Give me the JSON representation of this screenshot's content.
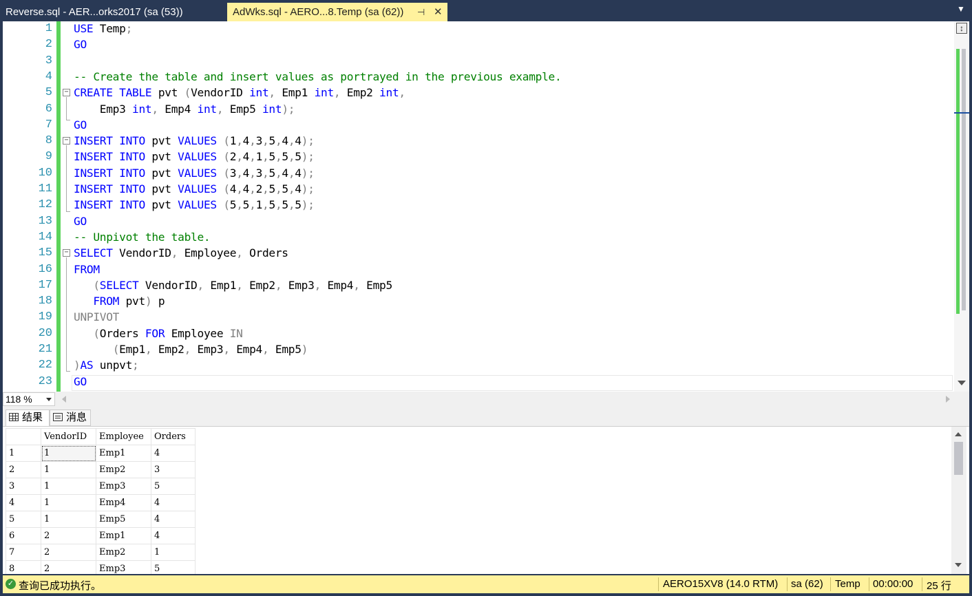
{
  "tabs": [
    {
      "label": "Reverse.sql - AER...orks2017 (sa (53))",
      "active": false
    },
    {
      "label": "AdWks.sql - AERO...8.Temp (sa (62))",
      "active": true
    }
  ],
  "tab_icons": {
    "pin": "pin-icon",
    "close": "close-icon",
    "overflow": "chevron-down-icon"
  },
  "editor": {
    "line_numbers": [
      "1",
      "2",
      "3",
      "4",
      "5",
      "6",
      "7",
      "8",
      "9",
      "10",
      "11",
      "12",
      "13",
      "14",
      "15",
      "16",
      "17",
      "18",
      "19",
      "20",
      "21",
      "22",
      "23"
    ],
    "lines": [
      [
        {
          "t": "USE",
          "c": "kw"
        },
        {
          "t": " Temp"
        },
        {
          "t": ";",
          "c": "gr"
        }
      ],
      [
        {
          "t": "GO",
          "c": "kw"
        }
      ],
      [],
      [
        {
          "t": "-- Create the table and insert values as portrayed in the previous example.",
          "c": "cm"
        }
      ],
      [
        {
          "t": "CREATE",
          "c": "kw"
        },
        {
          "t": " "
        },
        {
          "t": "TABLE",
          "c": "kw"
        },
        {
          "t": " pvt "
        },
        {
          "t": "(",
          "c": "gr"
        },
        {
          "t": "VendorID "
        },
        {
          "t": "int",
          "c": "kw"
        },
        {
          "t": ",",
          "c": "gr"
        },
        {
          "t": " Emp1 "
        },
        {
          "t": "int",
          "c": "kw"
        },
        {
          "t": ",",
          "c": "gr"
        },
        {
          "t": " Emp2 "
        },
        {
          "t": "int",
          "c": "kw"
        },
        {
          "t": ",",
          "c": "gr"
        }
      ],
      [
        {
          "t": "    Emp3 "
        },
        {
          "t": "int",
          "c": "kw"
        },
        {
          "t": ",",
          "c": "gr"
        },
        {
          "t": " Emp4 "
        },
        {
          "t": "int",
          "c": "kw"
        },
        {
          "t": ",",
          "c": "gr"
        },
        {
          "t": " Emp5 "
        },
        {
          "t": "int",
          "c": "kw"
        },
        {
          "t": ");",
          "c": "gr"
        }
      ],
      [
        {
          "t": "GO",
          "c": "kw"
        }
      ],
      [
        {
          "t": "INSERT",
          "c": "kw"
        },
        {
          "t": " "
        },
        {
          "t": "INTO",
          "c": "kw"
        },
        {
          "t": " pvt "
        },
        {
          "t": "VALUES",
          "c": "kw"
        },
        {
          "t": " "
        },
        {
          "t": "(",
          "c": "gr"
        },
        {
          "t": "1"
        },
        {
          "t": ",",
          "c": "gr"
        },
        {
          "t": "4"
        },
        {
          "t": ",",
          "c": "gr"
        },
        {
          "t": "3"
        },
        {
          "t": ",",
          "c": "gr"
        },
        {
          "t": "5"
        },
        {
          "t": ",",
          "c": "gr"
        },
        {
          "t": "4"
        },
        {
          "t": ",",
          "c": "gr"
        },
        {
          "t": "4"
        },
        {
          "t": ");",
          "c": "gr"
        }
      ],
      [
        {
          "t": "INSERT",
          "c": "kw"
        },
        {
          "t": " "
        },
        {
          "t": "INTO",
          "c": "kw"
        },
        {
          "t": " pvt "
        },
        {
          "t": "VALUES",
          "c": "kw"
        },
        {
          "t": " "
        },
        {
          "t": "(",
          "c": "gr"
        },
        {
          "t": "2"
        },
        {
          "t": ",",
          "c": "gr"
        },
        {
          "t": "4"
        },
        {
          "t": ",",
          "c": "gr"
        },
        {
          "t": "1"
        },
        {
          "t": ",",
          "c": "gr"
        },
        {
          "t": "5"
        },
        {
          "t": ",",
          "c": "gr"
        },
        {
          "t": "5"
        },
        {
          "t": ",",
          "c": "gr"
        },
        {
          "t": "5"
        },
        {
          "t": ");",
          "c": "gr"
        }
      ],
      [
        {
          "t": "INSERT",
          "c": "kw"
        },
        {
          "t": " "
        },
        {
          "t": "INTO",
          "c": "kw"
        },
        {
          "t": " pvt "
        },
        {
          "t": "VALUES",
          "c": "kw"
        },
        {
          "t": " "
        },
        {
          "t": "(",
          "c": "gr"
        },
        {
          "t": "3"
        },
        {
          "t": ",",
          "c": "gr"
        },
        {
          "t": "4"
        },
        {
          "t": ",",
          "c": "gr"
        },
        {
          "t": "3"
        },
        {
          "t": ",",
          "c": "gr"
        },
        {
          "t": "5"
        },
        {
          "t": ",",
          "c": "gr"
        },
        {
          "t": "4"
        },
        {
          "t": ",",
          "c": "gr"
        },
        {
          "t": "4"
        },
        {
          "t": ");",
          "c": "gr"
        }
      ],
      [
        {
          "t": "INSERT",
          "c": "kw"
        },
        {
          "t": " "
        },
        {
          "t": "INTO",
          "c": "kw"
        },
        {
          "t": " pvt "
        },
        {
          "t": "VALUES",
          "c": "kw"
        },
        {
          "t": " "
        },
        {
          "t": "(",
          "c": "gr"
        },
        {
          "t": "4"
        },
        {
          "t": ",",
          "c": "gr"
        },
        {
          "t": "4"
        },
        {
          "t": ",",
          "c": "gr"
        },
        {
          "t": "2"
        },
        {
          "t": ",",
          "c": "gr"
        },
        {
          "t": "5"
        },
        {
          "t": ",",
          "c": "gr"
        },
        {
          "t": "5"
        },
        {
          "t": ",",
          "c": "gr"
        },
        {
          "t": "4"
        },
        {
          "t": ");",
          "c": "gr"
        }
      ],
      [
        {
          "t": "INSERT",
          "c": "kw"
        },
        {
          "t": " "
        },
        {
          "t": "INTO",
          "c": "kw"
        },
        {
          "t": " pvt "
        },
        {
          "t": "VALUES",
          "c": "kw"
        },
        {
          "t": " "
        },
        {
          "t": "(",
          "c": "gr"
        },
        {
          "t": "5"
        },
        {
          "t": ",",
          "c": "gr"
        },
        {
          "t": "5"
        },
        {
          "t": ",",
          "c": "gr"
        },
        {
          "t": "1"
        },
        {
          "t": ",",
          "c": "gr"
        },
        {
          "t": "5"
        },
        {
          "t": ",",
          "c": "gr"
        },
        {
          "t": "5"
        },
        {
          "t": ",",
          "c": "gr"
        },
        {
          "t": "5"
        },
        {
          "t": ");",
          "c": "gr"
        }
      ],
      [
        {
          "t": "GO",
          "c": "kw"
        }
      ],
      [
        {
          "t": "-- Unpivot the table.",
          "c": "cm"
        }
      ],
      [
        {
          "t": "SELECT",
          "c": "kw"
        },
        {
          "t": " VendorID"
        },
        {
          "t": ",",
          "c": "gr"
        },
        {
          "t": " Employee"
        },
        {
          "t": ",",
          "c": "gr"
        },
        {
          "t": " Orders"
        }
      ],
      [
        {
          "t": "FROM",
          "c": "kw"
        }
      ],
      [
        {
          "t": "   "
        },
        {
          "t": "(",
          "c": "gr"
        },
        {
          "t": "SELECT",
          "c": "kw"
        },
        {
          "t": " VendorID"
        },
        {
          "t": ",",
          "c": "gr"
        },
        {
          "t": " Emp1"
        },
        {
          "t": ",",
          "c": "gr"
        },
        {
          "t": " Emp2"
        },
        {
          "t": ",",
          "c": "gr"
        },
        {
          "t": " Emp3"
        },
        {
          "t": ",",
          "c": "gr"
        },
        {
          "t": " Emp4"
        },
        {
          "t": ",",
          "c": "gr"
        },
        {
          "t": " Emp5"
        }
      ],
      [
        {
          "t": "   "
        },
        {
          "t": "FROM",
          "c": "kw"
        },
        {
          "t": " pvt"
        },
        {
          "t": ")",
          "c": "gr"
        },
        {
          "t": " p"
        }
      ],
      [
        {
          "t": "UNPIVOT",
          "c": "gr"
        }
      ],
      [
        {
          "t": "   "
        },
        {
          "t": "(",
          "c": "gr"
        },
        {
          "t": "Orders "
        },
        {
          "t": "FOR",
          "c": "kw"
        },
        {
          "t": " Employee "
        },
        {
          "t": "IN",
          "c": "gr"
        }
      ],
      [
        {
          "t": "      "
        },
        {
          "t": "(",
          "c": "gr"
        },
        {
          "t": "Emp1"
        },
        {
          "t": ",",
          "c": "gr"
        },
        {
          "t": " Emp2"
        },
        {
          "t": ",",
          "c": "gr"
        },
        {
          "t": " Emp3"
        },
        {
          "t": ",",
          "c": "gr"
        },
        {
          "t": " Emp4"
        },
        {
          "t": ",",
          "c": "gr"
        },
        {
          "t": " Emp5"
        },
        {
          "t": ")",
          "c": "gr"
        }
      ],
      [
        {
          "t": ")",
          "c": "gr"
        },
        {
          "t": "AS",
          "c": "kw"
        },
        {
          "t": " unpvt"
        },
        {
          "t": ";",
          "c": "gr"
        }
      ],
      [
        {
          "t": "GO",
          "c": "kw"
        }
      ]
    ]
  },
  "zoom": {
    "value": "118 %"
  },
  "results_tabs": [
    {
      "label": "结果",
      "icon": "grid-icon"
    },
    {
      "label": "消息",
      "icon": "message-icon"
    }
  ],
  "results": {
    "columns": [
      "VendorID",
      "Employee",
      "Orders"
    ],
    "rows": [
      {
        "n": "1",
        "cells": [
          "1",
          "Emp1",
          "4"
        ]
      },
      {
        "n": "2",
        "cells": [
          "1",
          "Emp2",
          "3"
        ]
      },
      {
        "n": "3",
        "cells": [
          "1",
          "Emp3",
          "5"
        ]
      },
      {
        "n": "4",
        "cells": [
          "1",
          "Emp4",
          "4"
        ]
      },
      {
        "n": "5",
        "cells": [
          "1",
          "Emp5",
          "4"
        ]
      },
      {
        "n": "6",
        "cells": [
          "2",
          "Emp1",
          "4"
        ]
      },
      {
        "n": "7",
        "cells": [
          "2",
          "Emp2",
          "1"
        ]
      },
      {
        "n": "8",
        "cells": [
          "2",
          "Emp3",
          "5"
        ]
      }
    ]
  },
  "status": {
    "message": "查询已成功执行。",
    "server": "AERO15XV8 (14.0 RTM)",
    "user": "sa (62)",
    "database": "Temp",
    "elapsed": "00:00:00",
    "rows": "25 行"
  },
  "colors": {
    "title_bg": "#293955",
    "active_tab": "#fff29d",
    "keyword": "#0000ff",
    "comment": "#008000",
    "operator": "#808080",
    "line_number": "#2b91af",
    "change_bar": "#5bd35b",
    "status_bg": "#fff29d"
  }
}
